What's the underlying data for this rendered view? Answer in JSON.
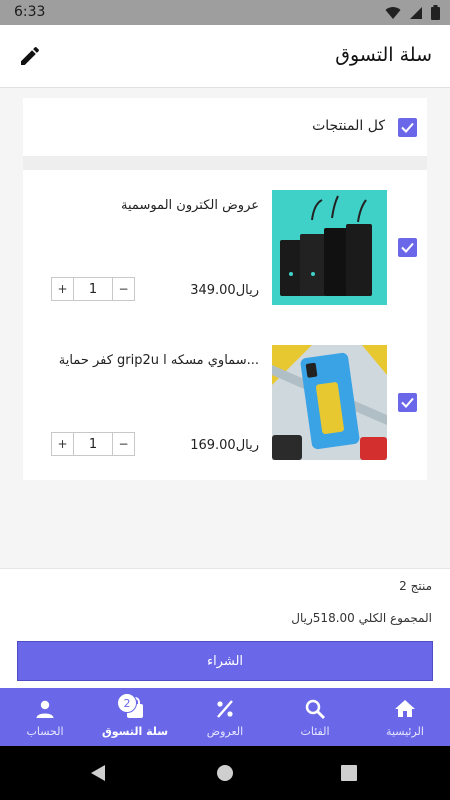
{
  "status_bar": {
    "time": "6:33"
  },
  "app_bar": {
    "title": "سلة التسوق"
  },
  "select_all": {
    "label": "كل المنتجات",
    "checked": true
  },
  "items": [
    {
      "name": "عروض الكترون الموسمية",
      "price": "349.00ريال",
      "quantity": "1",
      "checked": true,
      "image_icon": "power-bank-image",
      "plus": "+",
      "minus": "−"
    },
    {
      "name": "كفر حماية grip2u سماوي مسكه ا...",
      "price": "169.00ريال",
      "quantity": "1",
      "checked": true,
      "image_icon": "phone-case-image",
      "plus": "+",
      "minus": "−"
    }
  ],
  "summary": {
    "count_text": "2 منتج",
    "total_text": "المجموع الكلي 518.00ريال",
    "buy_label": "الشراء"
  },
  "bottom_nav": [
    {
      "label": "الرئيسية",
      "icon": "home-icon"
    },
    {
      "label": "الفئات",
      "icon": "search-icon"
    },
    {
      "label": "العروض",
      "icon": "percent-icon"
    },
    {
      "label": "سلة التسوق",
      "icon": "cart-icon",
      "badge": "2",
      "active": true
    },
    {
      "label": "الحساب",
      "icon": "person-icon"
    }
  ],
  "colors": {
    "accent": "#6a68e8",
    "status_bar": "#9e9e9e"
  }
}
